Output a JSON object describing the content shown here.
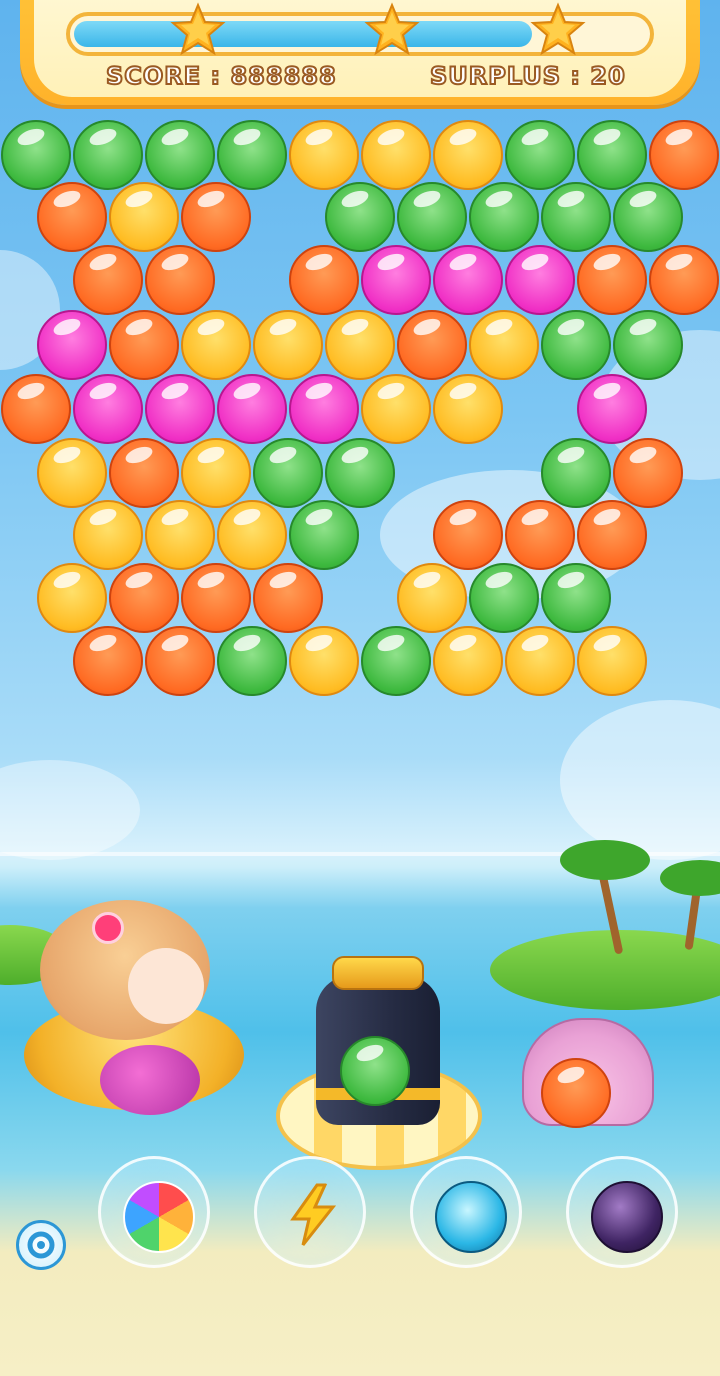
{
  "hud": {
    "score_label": "SCORE : 888888",
    "surplus_label": "SURPLUS : 20",
    "progress_fraction": 0.8,
    "stars_count": 3
  },
  "bubble_grid": {
    "rows": [
      [
        "green",
        "green",
        "green",
        "green",
        "yellow",
        "yellow",
        "yellow",
        "green",
        "green",
        "orange"
      ],
      [
        "orange",
        "yellow",
        "orange",
        "",
        "green",
        "green",
        "green",
        "green",
        "green"
      ],
      [
        "",
        "orange",
        "orange",
        "",
        "orange",
        "pink",
        "pink",
        "pink",
        "orange",
        "orange"
      ],
      [
        "pink",
        "orange",
        "yellow",
        "yellow",
        "yellow",
        "orange",
        "yellow",
        "green",
        "green"
      ],
      [
        "orange",
        "pink",
        "pink",
        "pink",
        "pink",
        "yellow",
        "yellow",
        "",
        "pink",
        ""
      ],
      [
        "yellow",
        "orange",
        "yellow",
        "green",
        "green",
        "",
        "",
        "green",
        "orange"
      ],
      [
        "",
        "yellow",
        "yellow",
        "yellow",
        "green",
        "",
        "orange",
        "orange",
        "orange",
        ""
      ],
      [
        "yellow",
        "orange",
        "orange",
        "orange",
        "",
        "yellow",
        "green",
        "green"
      ],
      [
        "",
        "orange",
        "orange",
        "green",
        "yellow",
        "green",
        "yellow",
        "yellow",
        "yellow",
        ""
      ]
    ]
  },
  "launcher": {
    "current_bubble": "green",
    "next_bubble": "orange"
  },
  "powerups": [
    {
      "name": "rainbow-ball"
    },
    {
      "name": "lightning"
    },
    {
      "name": "ice-crack-ball"
    },
    {
      "name": "bomb"
    }
  ],
  "colors": {
    "green": "#3db93e",
    "yellow": "#ffbc22",
    "orange": "#ff6a22",
    "pink": "#f02fc5",
    "hud_gold": "#ffb22a",
    "progress_blue": "#3bb6e9"
  }
}
